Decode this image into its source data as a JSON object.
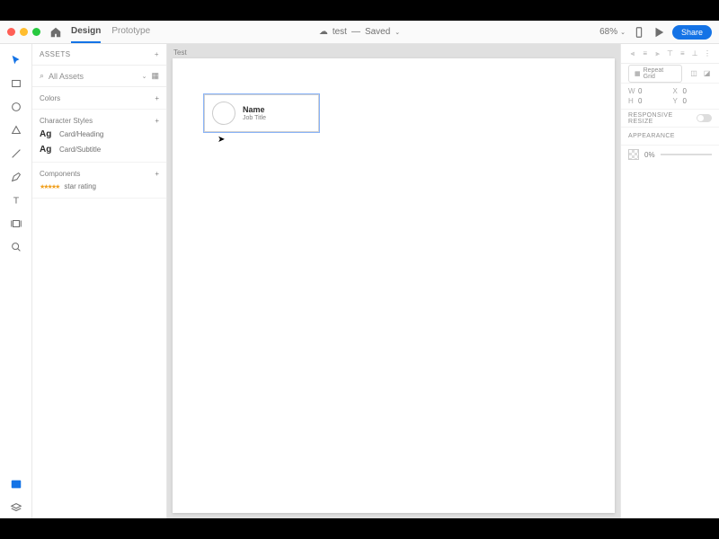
{
  "titlebar": {
    "tabs": {
      "design": "Design",
      "prototype": "Prototype"
    },
    "doc_name": "test",
    "doc_status": "Saved",
    "zoom": "68%",
    "share": "Share"
  },
  "assets": {
    "header": "ASSETS",
    "search_label": "All Assets",
    "sections": {
      "colors": "Colors",
      "char_styles": "Character Styles",
      "components": "Components"
    },
    "styles": [
      {
        "sample": "Ag",
        "name": "Card/Heading"
      },
      {
        "sample": "Ag",
        "name": "Card/Subtitle"
      }
    ],
    "components": [
      {
        "name": "star rating"
      }
    ]
  },
  "canvas": {
    "artboard_label": "Test",
    "card": {
      "name": "Name",
      "subtitle": "Job Title"
    }
  },
  "inspector": {
    "repeat_grid": "Repeat Grid",
    "pos": {
      "w_label": "W",
      "w_val": "0",
      "h_label": "X",
      "h_val": "0",
      "h2_label": "H",
      "h2_val": "0",
      "y_label": "Y",
      "y_val": "0"
    },
    "responsive": "RESPONSIVE RESIZE",
    "appearance": "APPEARANCE",
    "opacity": "0%"
  }
}
